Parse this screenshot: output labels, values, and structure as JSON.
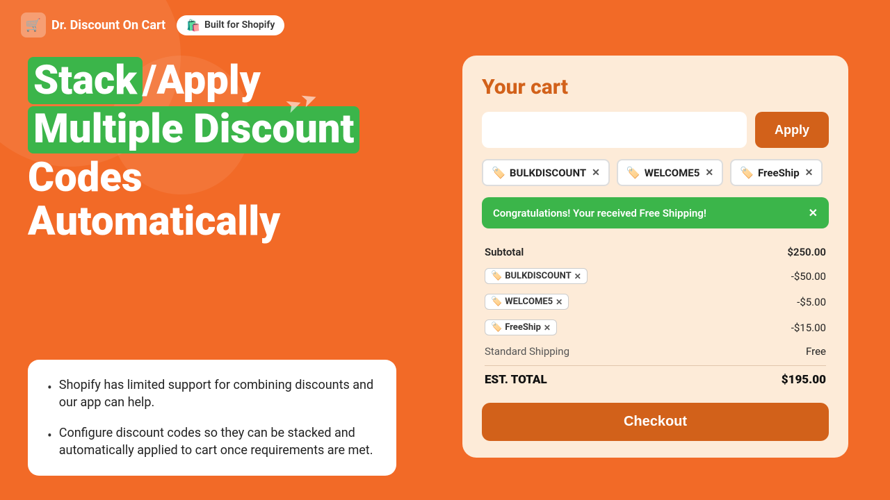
{
  "header": {
    "logo_text": "Dr. Discount On Cart",
    "shopify_badge": "Built for Shopify"
  },
  "hero": {
    "line1_highlight": "Stack",
    "line1_slash": "/",
    "line1_rest": "Apply",
    "line2": "Multiple Discount",
    "line3": "Codes Automatically"
  },
  "bullets": [
    {
      "text": "Shopify has limited support for combining discounts and our app can help."
    },
    {
      "text": "Configure discount codes so they can be stacked and automatically applied to cart once requirements are met."
    }
  ],
  "cart": {
    "title": "Your cart",
    "coupon_input_placeholder": "",
    "apply_button": "Apply",
    "tags": [
      {
        "label": "BULKDISCOUNT"
      },
      {
        "label": "WELCOME5"
      },
      {
        "label": "FreeShip"
      }
    ],
    "success_message": "Congratulations! Your received Free Shipping!",
    "lines": [
      {
        "label": "Subtotal",
        "value": "$250.00",
        "type": "subtotal"
      },
      {
        "label": "BULKDISCOUNT",
        "value": "-$50.00",
        "type": "discount"
      },
      {
        "label": "WELCOME5",
        "value": "-$5.00",
        "type": "discount"
      },
      {
        "label": "FreeShip",
        "value": "-$15.00",
        "type": "discount"
      },
      {
        "label": "Standard Shipping",
        "value": "Free",
        "type": "shipping"
      },
      {
        "label": "EST. TOTAL",
        "value": "$195.00",
        "type": "total"
      }
    ],
    "checkout_button": "Checkout"
  }
}
